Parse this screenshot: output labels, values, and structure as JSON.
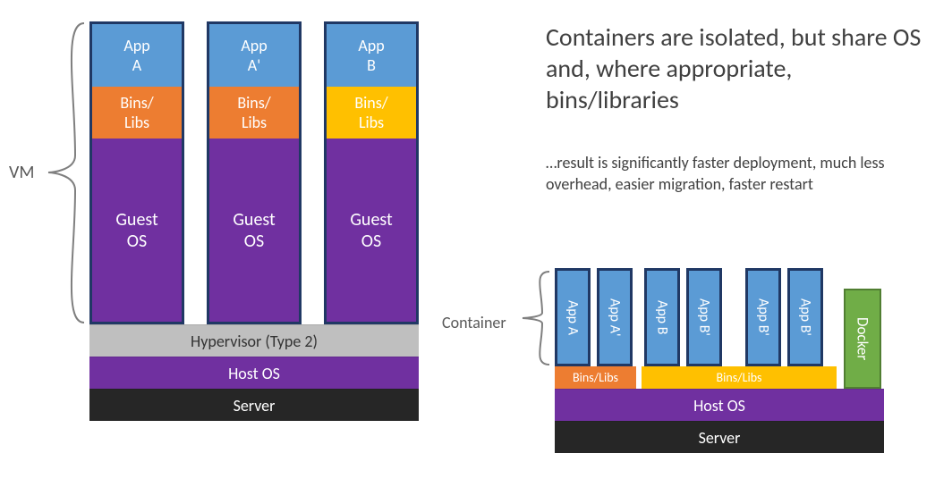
{
  "vm": {
    "label": "VM",
    "columns": [
      {
        "app": "App\nA",
        "bins": "Bins/\nLibs",
        "bins_color": "orange",
        "guest": "Guest\nOS"
      },
      {
        "app": "App\nA'",
        "bins": "Bins/\nLibs",
        "bins_color": "orange",
        "guest": "Guest\nOS"
      },
      {
        "app": "App\nB",
        "bins": "Bins/\nLibs",
        "bins_color": "yellow",
        "guest": "Guest\nOS"
      }
    ],
    "hypervisor": "Hypervisor (Type 2)",
    "host_os": "Host OS",
    "server": "Server"
  },
  "container": {
    "label": "Container",
    "apps": [
      "App A",
      "App A'",
      "App B",
      "App B'",
      "App B'",
      "App B'"
    ],
    "bins1": "Bins/Libs",
    "bins2": "Bins/Libs",
    "docker": "Docker",
    "host_os": "Host OS",
    "server": "Server"
  },
  "text": {
    "heading": "Containers are isolated, but share OS and, where appropriate, bins/libraries",
    "sub": "…result is significantly faster deployment, much less overhead, easier migration, faster restart"
  },
  "colors": {
    "blue": "#5B9BD5",
    "orange": "#ED7D31",
    "yellow": "#FFC000",
    "purple": "#7030A0",
    "grey": "#BFBFBF",
    "black": "#262626",
    "green": "#70AD47",
    "border": "#203864"
  }
}
